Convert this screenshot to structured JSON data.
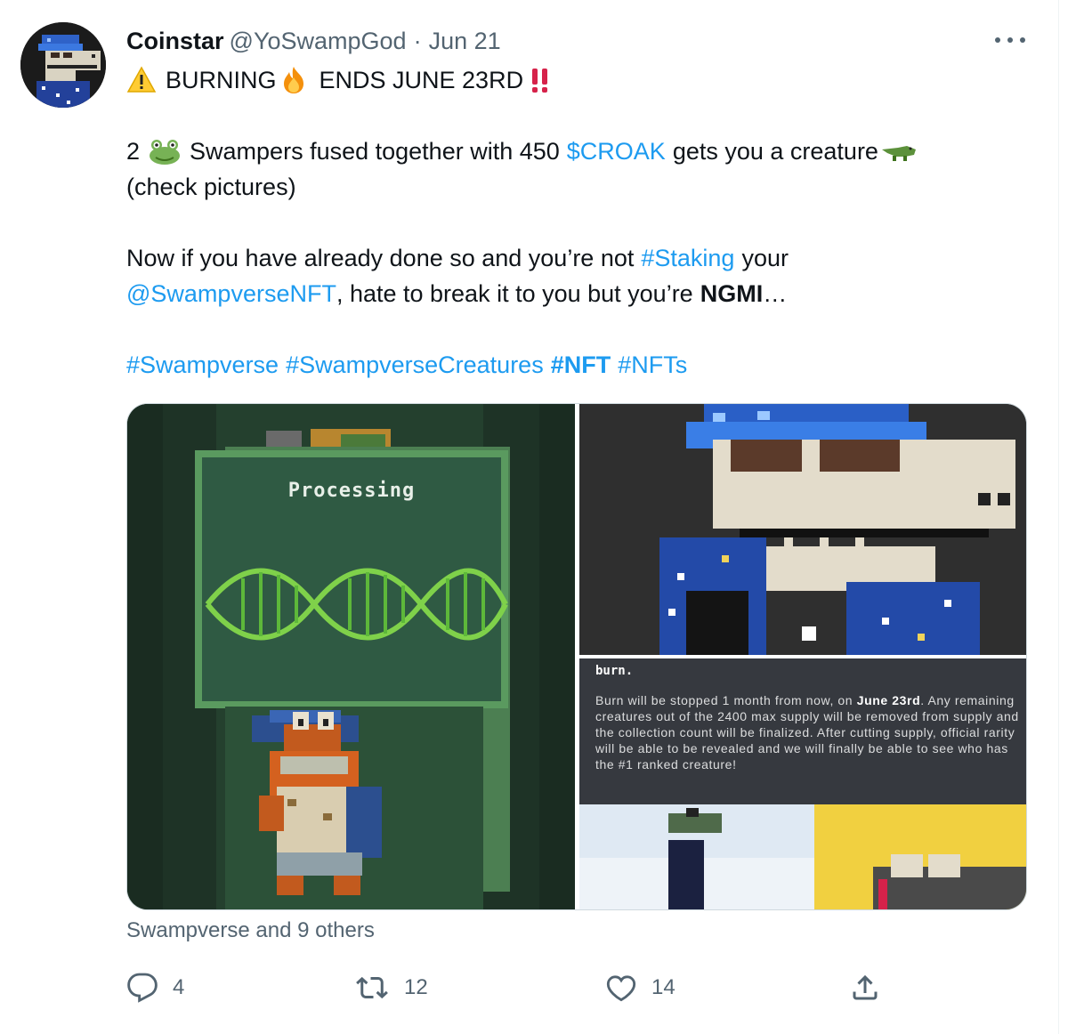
{
  "tweet": {
    "author_name": "Coinstar",
    "author_handle": "@YoSwampGod",
    "separator": "·",
    "date": "Jun 21",
    "line1": {
      "text_a": "BURNING",
      "text_b": "ENDS JUNE 23RD"
    },
    "line2": {
      "prefix": "2",
      "text_a": "Swampers fused together with 450",
      "cashtag": "$CROAK",
      "text_b": "gets you a creature"
    },
    "line3": "(check pictures)",
    "line4": {
      "text_a": "Now if you have already done so and you’re not",
      "hashtag": "#Staking",
      "text_b": "your"
    },
    "line5": {
      "mention": "@SwampverseNFT",
      "text_a": ", hate to break it to you but you’re",
      "bold": "NGMI",
      "text_b": "…"
    },
    "hashtags": {
      "h1": "#Swampverse",
      "h2": "#SwampverseCreatures",
      "h3": "#NFT",
      "h4": "#NFTs"
    }
  },
  "media": {
    "processing_label": "Processing",
    "announcement_title": "burn.",
    "announcement_a": "Burn will be stopped 1 month from now, on",
    "announcement_date": "June 23rd",
    "announcement_b": ". Any remaining creatures out of the 2400 max supply will be removed from supply and the collection count will be finalized. After cutting supply, official rarity will be able to be revealed and we will finally be able to see who has the #1 ranked creature!"
  },
  "tagged": "Swampverse and 9 others",
  "actions": {
    "replies": "4",
    "retweets": "12",
    "likes": "14"
  },
  "icons": {
    "avatar": "crocodile-avatar",
    "more": "more-dots-icon",
    "reply": "reply-icon",
    "retweet": "retweet-icon",
    "like": "heart-icon",
    "share": "share-icon",
    "warning": "warning-emoji",
    "fire": "fire-emoji",
    "exclaim": "double-exclamation-emoji",
    "frog": "frog-emoji",
    "croc": "crocodile-emoji"
  },
  "colors": {
    "link": "#1d9bf0",
    "text": "#0f1419",
    "secondary": "#536471",
    "exclaim": "#d6224a"
  }
}
